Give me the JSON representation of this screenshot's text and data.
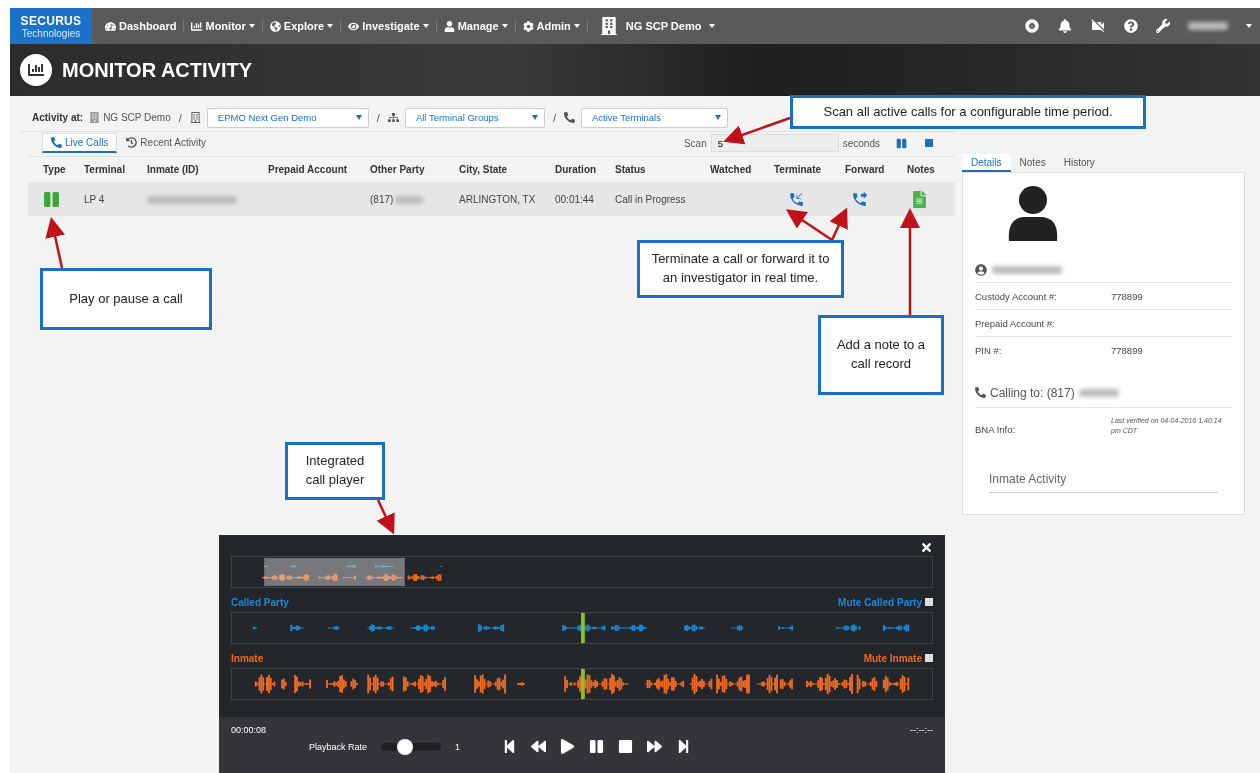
{
  "nav": {
    "logo_title": "SECURUS",
    "logo_subtitle": "Technologies",
    "items": [
      {
        "label": "Dashboard",
        "dropdown": false
      },
      {
        "label": "Monitor",
        "dropdown": true
      },
      {
        "label": "Explore",
        "dropdown": true
      },
      {
        "label": "Investigate",
        "dropdown": true
      },
      {
        "label": "Manage",
        "dropdown": true
      },
      {
        "label": "Admin",
        "dropdown": true
      }
    ],
    "facility": "NG SCP Demo"
  },
  "page_title": "MONITOR ACTIVITY",
  "filters": {
    "label": "Activity at:",
    "separator": "/",
    "site": "NG SCP Demo",
    "facility_select": "EPMO Next Gen Demo",
    "group_select": "All Terminal Groups",
    "terminal_select": "Active Terminals"
  },
  "tabs": [
    {
      "label": "Live Calls",
      "selected": true
    },
    {
      "label": "Recent Activity",
      "selected": false
    }
  ],
  "scan": {
    "label": "Scan",
    "value": "5",
    "unit": "seconds"
  },
  "table": {
    "columns": [
      "Type",
      "Terminal",
      "Inmate (ID)",
      "Prepaid Account",
      "Other Party",
      "City, State",
      "Duration",
      "Status",
      "Watched",
      "Terminate",
      "Forward",
      "Notes"
    ],
    "rows": [
      {
        "playing": true,
        "terminal": "LP 4",
        "other_party": "(817)",
        "city_state": "ARLINGTON, TX",
        "duration": "00:01:44",
        "status": "Call in Progress"
      }
    ]
  },
  "details": {
    "tabs": [
      {
        "label": "Details",
        "selected": true
      },
      {
        "label": "Notes",
        "selected": false
      },
      {
        "label": "History",
        "selected": false
      }
    ],
    "fields": [
      {
        "label": "Custody Account #:",
        "value": "778899"
      },
      {
        "label": "Prepaid Account #:"
      },
      {
        "label": "PIN #:",
        "value": "778899"
      }
    ],
    "calling_to": "Calling to: (817)",
    "bna_label": "BNA Info:",
    "bna_note": "Last verified on 04-04-2016 1:40:14 pm CDT",
    "section": "Inmate Activity"
  },
  "player": {
    "called_party": {
      "label": "Called Party",
      "mute_label": "Mute Called Party",
      "muted": false
    },
    "inmate": {
      "label": "Inmate",
      "mute_label": "Mute Inmate",
      "muted": false
    },
    "playhead": {
      "level": 0.5
    },
    "time": "00:00:08",
    "end_time": "--:--:--",
    "rate_label": "Playback Rate",
    "rate": {
      "level": 0.4
    },
    "rate_value": "1"
  },
  "callouts": [
    {
      "text": "Scan all active calls for a configurable time period."
    },
    {
      "text": "Terminate a call or forward it to an investigator in real time."
    },
    {
      "text": "Play or pause a call"
    },
    {
      "text": "Add a note to a call record"
    },
    {
      "text": "Integrated call player"
    }
  ]
}
